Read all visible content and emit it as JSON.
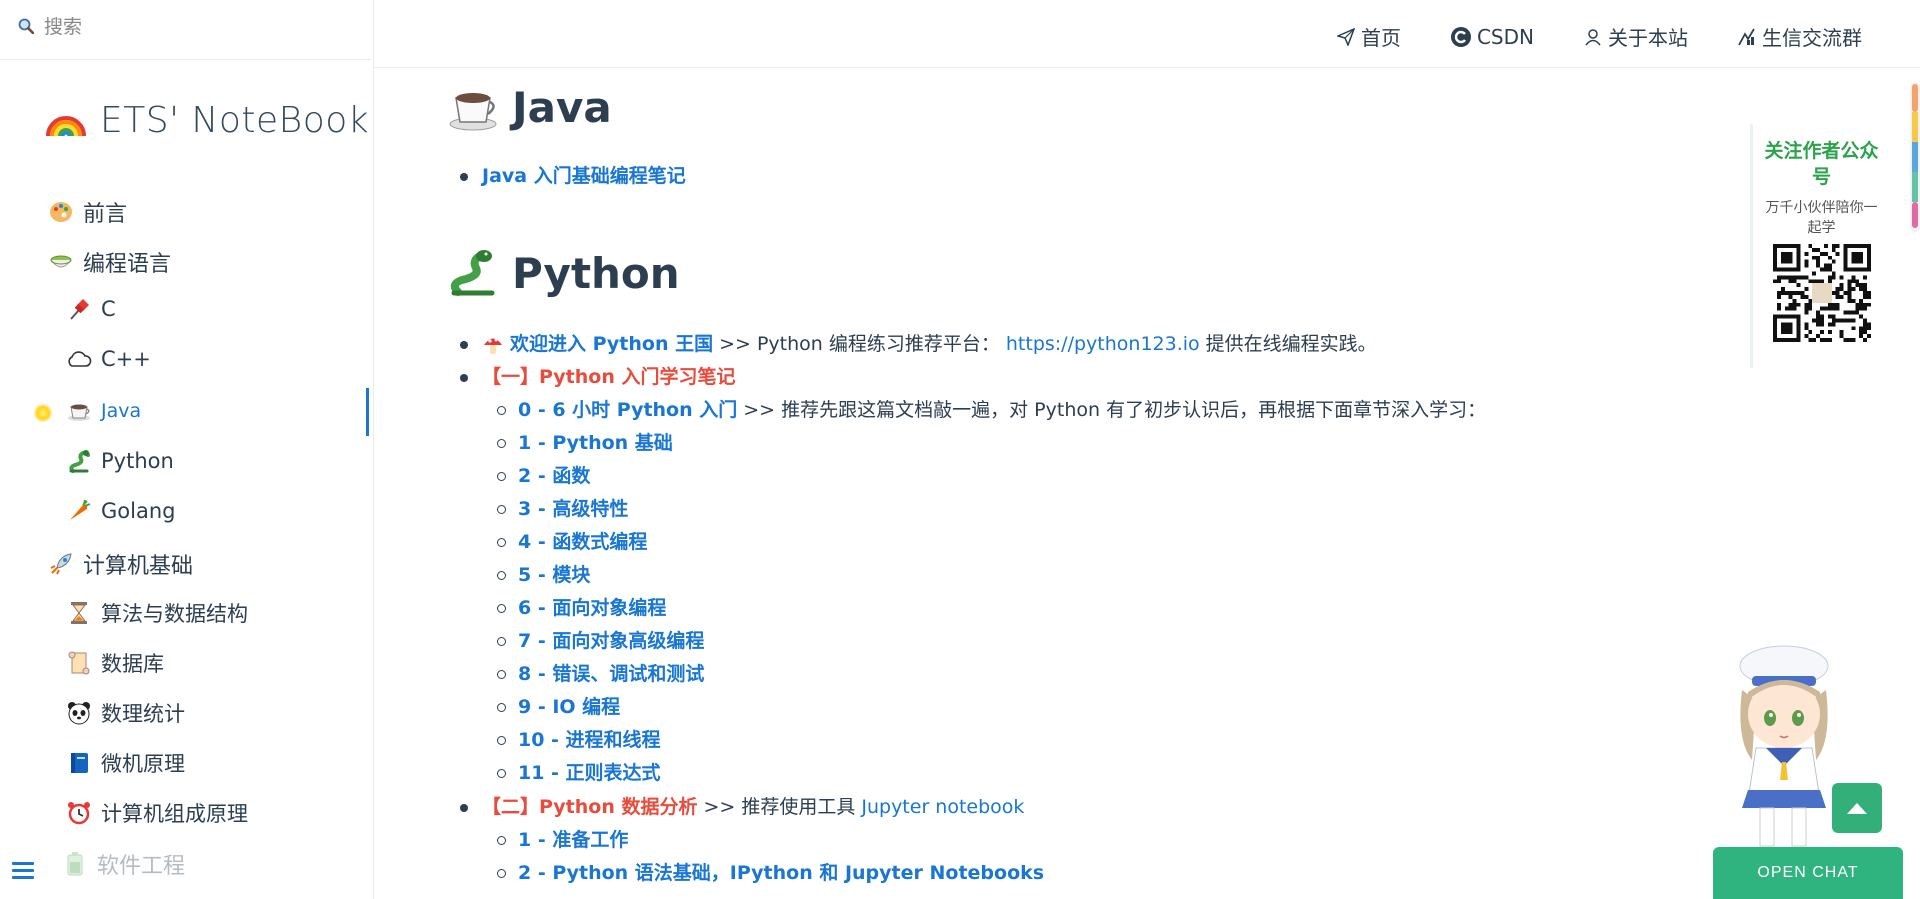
{
  "search": {
    "placeholder": "搜索"
  },
  "site": {
    "title": "ETS' NoteBook",
    "logo_icon": "rainbow-icon"
  },
  "sidebar": {
    "items": [
      {
        "label": "前言",
        "icon": "palette-icon"
      },
      {
        "label": "编程语言",
        "icon": "bowl-icon"
      },
      {
        "label": "C",
        "icon": "pushpin-icon"
      },
      {
        "label": "C++",
        "icon": "cloud-icon"
      },
      {
        "label": "Java",
        "icon": "coffee-icon",
        "active": true
      },
      {
        "label": "Python",
        "icon": "snake-icon"
      },
      {
        "label": "Golang",
        "icon": "carrot-icon"
      },
      {
        "label": "计算机基础",
        "icon": "rocket-icon"
      },
      {
        "label": "算法与数据结构",
        "icon": "hourglass-icon"
      },
      {
        "label": "数据库",
        "icon": "scroll-icon"
      },
      {
        "label": "数理统计",
        "icon": "panda-icon"
      },
      {
        "label": "微机原理",
        "icon": "book-icon"
      },
      {
        "label": "计算机组成原理",
        "icon": "alarm-clock-icon"
      },
      {
        "label": "软件工程",
        "icon": "battery-icon"
      }
    ]
  },
  "navbar": {
    "links": [
      {
        "label": "首页",
        "icon": "paper-plane-icon"
      },
      {
        "label": "CSDN",
        "icon": "csdn-icon"
      },
      {
        "label": "关于本站",
        "icon": "user-icon"
      },
      {
        "label": "生信交流群",
        "icon": "chart-icon"
      }
    ]
  },
  "content": {
    "java": {
      "heading": "Java",
      "items": [
        {
          "link": "Java 入门基础编程笔记"
        }
      ]
    },
    "python": {
      "heading": "Python",
      "welcome_link": "欢迎进入 Python 王国",
      "welcome_text": ">> Python 编程练习推荐平台：",
      "welcome_url": "https://python123.io",
      "welcome_tail": "提供在线编程实践。",
      "part1_label": "【一】Python 入门学习笔记",
      "part1_intro_link": "0 - 6 小时 Python 入门",
      "part1_intro_text": ">> 推荐先跟这篇文档敲一遍，对 Python 有了初步认识后，再根据下面章节深入学习：",
      "part1_items": [
        "1 - Python 基础",
        "2 - 函数",
        "3 - 高级特性",
        "4 - 函数式编程",
        "5 - 模块",
        "6 - 面向对象编程",
        "7 - 面向对象高级编程",
        "8 - 错误、调试和测试",
        "9 - IO 编程",
        "10 - 进程和线程",
        "11 - 正则表达式"
      ],
      "part2_label": "【二】Python 数据分析",
      "part2_text": ">> 推荐使用工具",
      "part2_tool": "Jupyter notebook",
      "part2_items": [
        "1 - 准备工作",
        "2 - Python 语法基础，IPython 和 Jupyter Notebooks"
      ]
    }
  },
  "promo": {
    "title": "关注作者公众号",
    "subtitle": "万千小伙伴陪你一起学"
  },
  "chat": {
    "label": "OPEN CHAT"
  },
  "colors": {
    "link": "#1976d2",
    "accent_red": "#e74c3c",
    "brand_green": "#2fb37f",
    "text": "#2c3e50"
  }
}
